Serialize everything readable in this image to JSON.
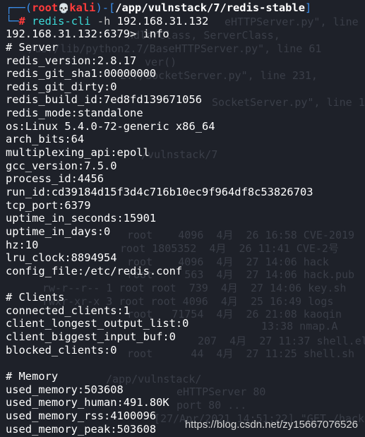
{
  "prompt": {
    "top_left": "┌──",
    "open": "(",
    "user": "root",
    "skull": "💀",
    "host": "kali",
    "close": ")-[",
    "path": "/app/vulnstack/7/redis-stable",
    "end": "]",
    "bottom_left": "└─",
    "hash": "#",
    "command": "redis-cli",
    "option": "-h",
    "argument": "192.168.31.132"
  },
  "redis_prompt": "192.168.31.132:6379>",
  "redis_command": "info",
  "output_lines": [
    "# Server",
    "redis_version:2.8.17",
    "redis_git_sha1:00000000",
    "redis_git_dirty:0",
    "redis_build_id:7ed8fd139671056",
    "redis_mode:standalone",
    "os:Linux 5.4.0-72-generic x86_64",
    "arch_bits:64",
    "multiplexing_api:epoll",
    "gcc_version:7.5.0",
    "process_id:4456",
    "run_id:cd39184d15f3d4c716b10ec9f964df8c53826703",
    "tcp_port:6379",
    "uptime_in_seconds:15901",
    "uptime_in_days:0",
    "hz:10",
    "lru_clock:8894954",
    "config_file:/etc/redis.conf",
    "",
    "# Clients",
    "connected_clients:1",
    "client_longest_output_list:0",
    "client_biggest_input_buf:0",
    "blocked_clients:0",
    "",
    "# Memory",
    "used_memory:503608",
    "used_memory_human:491.80K",
    "used_memory_rss:4100096",
    "used_memory_peak:503608"
  ],
  "watermark": "https://blog.csdn.net/zy15667076526",
  "colors": {
    "background": "#1e2129",
    "prompt_frame": "#3b8eea",
    "user_host": "#ff3b3b",
    "command": "#3ddbd9",
    "text": "#ffffff"
  }
}
